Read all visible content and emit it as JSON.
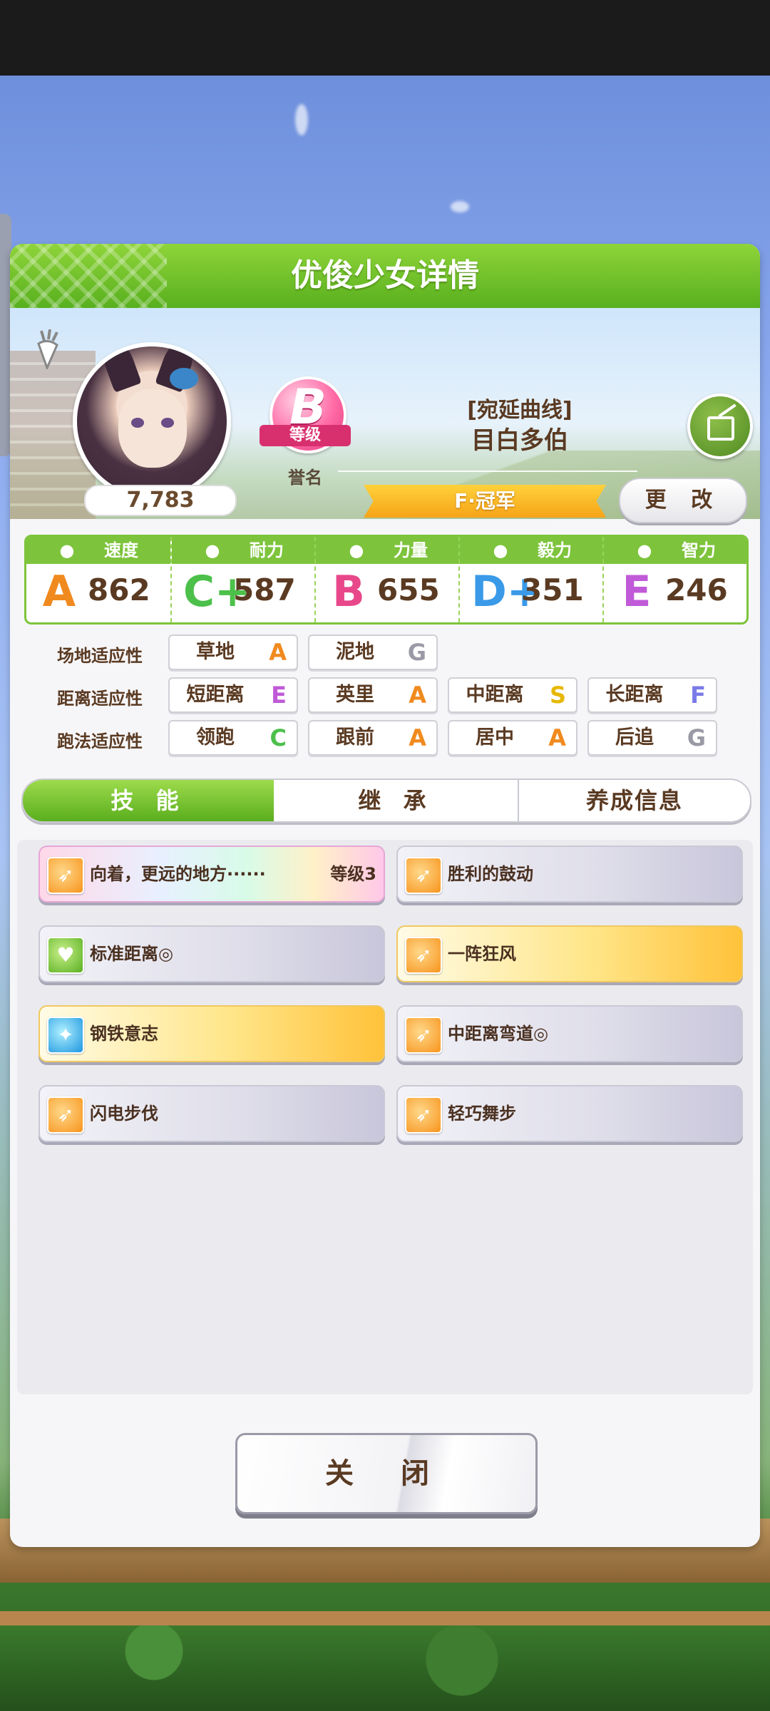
{
  "dialog": {
    "title": "优俊少女详情"
  },
  "profile": {
    "fans": "7,783",
    "rank": {
      "letter": "B",
      "label": "等级",
      "sub": "誉名"
    },
    "title": "[宛延曲线]",
    "name": "目白多伯",
    "race_title": "F·冠军",
    "change_label": "更 改",
    "comment": "-"
  },
  "stats": [
    {
      "name": "速度",
      "grade": "A",
      "value": "862",
      "color": "#f08a1e",
      "icon": "shoe-icon"
    },
    {
      "name": "耐力",
      "grade": "C+",
      "value": "587",
      "color": "#4cc04a",
      "icon": "heart-icon"
    },
    {
      "name": "力量",
      "grade": "B",
      "value": "655",
      "color": "#e8488a",
      "icon": "muscle-icon"
    },
    {
      "name": "毅力",
      "grade": "D+",
      "value": "351",
      "color": "#3a9ae8",
      "icon": "flame-icon"
    },
    {
      "name": "智力",
      "grade": "E",
      "value": "246",
      "color": "#c05ad8",
      "icon": "graduation-cap-icon"
    }
  ],
  "aptitude": {
    "track": {
      "label": "场地适应性",
      "items": [
        {
          "name": "草地",
          "grade": "A"
        },
        {
          "name": "泥地",
          "grade": "G"
        }
      ]
    },
    "distance": {
      "label": "距离适应性",
      "items": [
        {
          "name": "短距离",
          "grade": "E"
        },
        {
          "name": "英里",
          "grade": "A"
        },
        {
          "name": "中距离",
          "grade": "S"
        },
        {
          "name": "长距离",
          "grade": "F"
        }
      ]
    },
    "style": {
      "label": "跑法适应性",
      "items": [
        {
          "name": "领跑",
          "grade": "C"
        },
        {
          "name": "跟前",
          "grade": "A"
        },
        {
          "name": "居中",
          "grade": "A"
        },
        {
          "name": "后追",
          "grade": "G"
        }
      ]
    },
    "grade_colors": {
      "S": "#e6b800",
      "A": "#f08a1e",
      "C": "#4cc04a",
      "E": "#c05ad8",
      "F": "#7a7ae8",
      "G": "#9a9aa6"
    }
  },
  "tabs": [
    "技 能",
    "继 承",
    "养成信息"
  ],
  "skills": [
    {
      "name": "向着，更远的地方······",
      "level": "等级3",
      "style": "rainbow",
      "icon": "orange"
    },
    {
      "name": "胜利的鼓动",
      "style": "normal",
      "icon": "orange"
    },
    {
      "name": "标准距离◎",
      "style": "normal",
      "icon": "green"
    },
    {
      "name": "一阵狂风",
      "style": "gold",
      "icon": "orange"
    },
    {
      "name": "钢铁意志",
      "style": "gold",
      "icon": "blue"
    },
    {
      "name": "中距离弯道◎",
      "style": "normal",
      "icon": "orange"
    },
    {
      "name": "闪电步伐",
      "style": "normal",
      "icon": "orange"
    },
    {
      "name": "轻巧舞步",
      "style": "normal",
      "icon": "orange"
    }
  ],
  "close_label": "关 闭"
}
